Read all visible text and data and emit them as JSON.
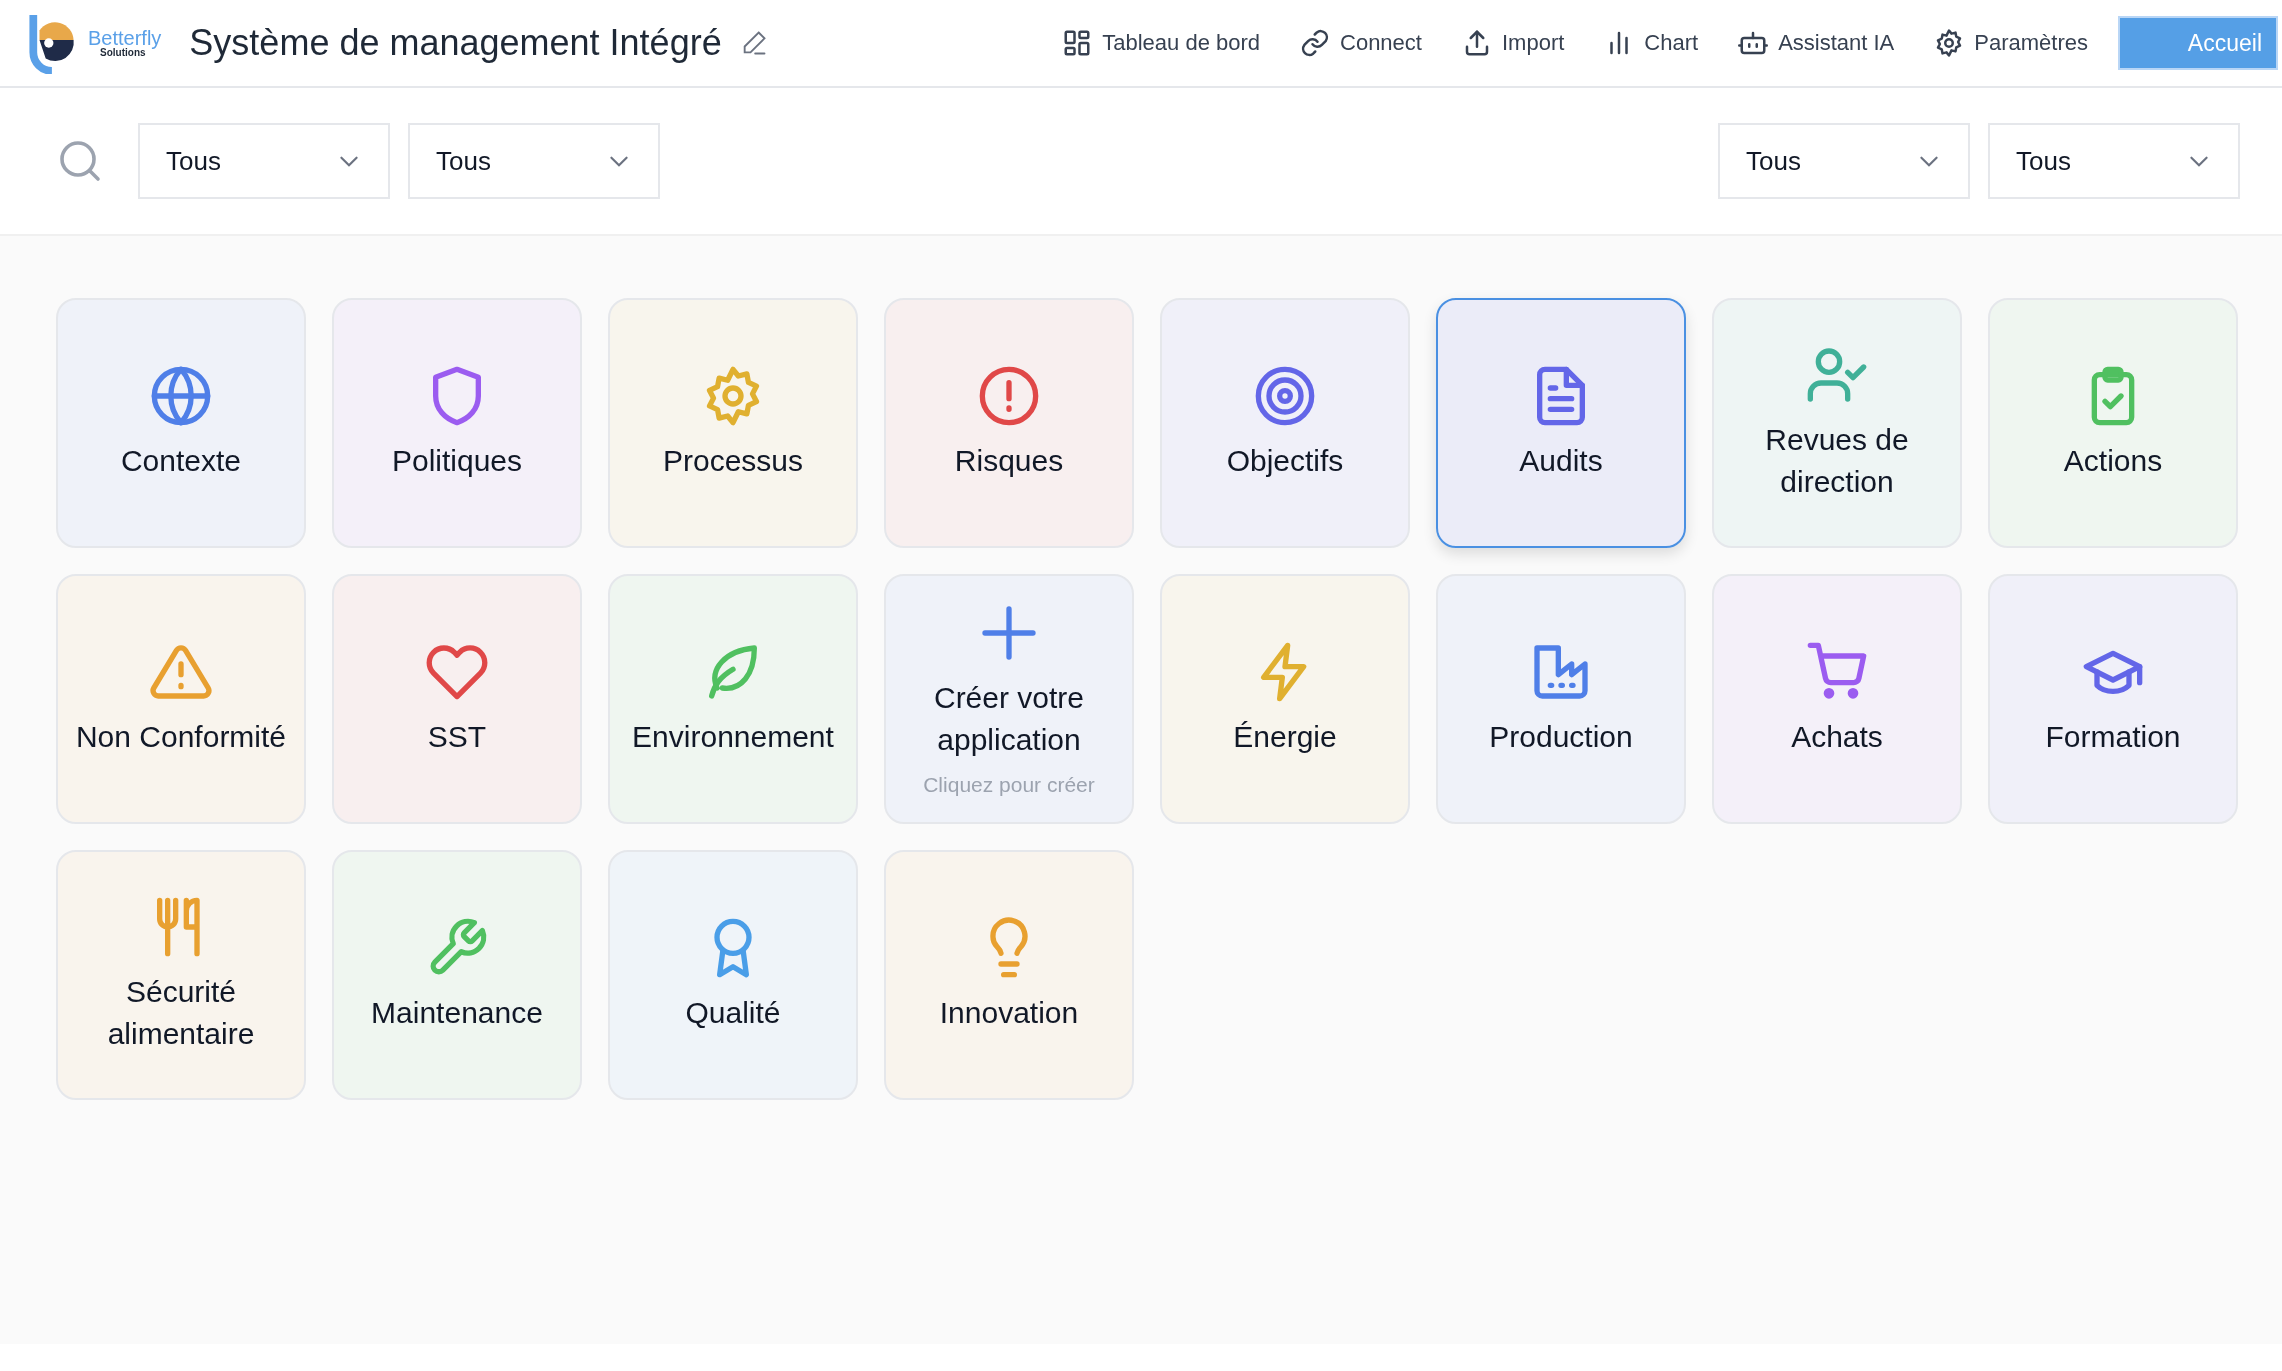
{
  "header": {
    "logo": {
      "name": "Betterfly",
      "tagline": "Solutions"
    },
    "title": "Système de management Intégré",
    "nav": [
      {
        "label": "Tableau de bord",
        "kind": "grid"
      },
      {
        "label": "Connect",
        "kind": "link"
      },
      {
        "label": "Import",
        "kind": "upload"
      },
      {
        "label": "Chart",
        "kind": "bars"
      },
      {
        "label": "Assistant IA",
        "kind": "robot"
      },
      {
        "label": "Paramètres",
        "kind": "gear"
      }
    ],
    "home_button": "Accueil"
  },
  "filters": {
    "left": [
      "Tous",
      "Tous"
    ],
    "right": [
      "Tous",
      "Tous"
    ]
  },
  "tiles": [
    {
      "label": "Contexte",
      "kind": "globe",
      "color": "#4f7fe8",
      "selected": false
    },
    {
      "label": "Politiques",
      "kind": "shield",
      "color": "#9b5cf0",
      "selected": false
    },
    {
      "label": "Processus",
      "kind": "gear",
      "color": "#e0b030",
      "selected": false
    },
    {
      "label": "Risques",
      "kind": "alert",
      "color": "#e04848",
      "selected": false
    },
    {
      "label": "Objectifs",
      "kind": "target",
      "color": "#6366e8",
      "selected": false
    },
    {
      "label": "Audits",
      "kind": "doc",
      "color": "#6366e8",
      "selected": true
    },
    {
      "label": "Revues de direction",
      "kind": "usercheck",
      "color": "#40b098",
      "selected": false
    },
    {
      "label": "Actions",
      "kind": "clipboard",
      "color": "#50c060",
      "selected": false
    },
    {
      "label": "Non Conformité",
      "kind": "warning",
      "color": "#e8a030",
      "selected": false
    },
    {
      "label": "SST",
      "kind": "heart",
      "color": "#e04848",
      "selected": false
    },
    {
      "label": "Environnement",
      "kind": "leaf",
      "color": "#50c060",
      "selected": false
    },
    {
      "label": "Créer votre application",
      "kind": "plus",
      "color": "#4f7fe8",
      "subtitle": "Cliquez pour créer",
      "selected": false
    },
    {
      "label": "Énergie",
      "kind": "bolt",
      "color": "#e0b030",
      "selected": false
    },
    {
      "label": "Production",
      "kind": "factory",
      "color": "#4f7fe8",
      "selected": false
    },
    {
      "label": "Achats",
      "kind": "cart",
      "color": "#9b5cf0",
      "selected": false
    },
    {
      "label": "Formation",
      "kind": "cap",
      "color": "#6366e8",
      "selected": false
    },
    {
      "label": "Sécurité alimentaire",
      "kind": "fork",
      "color": "#e8a030",
      "selected": false
    },
    {
      "label": "Maintenance",
      "kind": "wrench",
      "color": "#50c060",
      "selected": false
    },
    {
      "label": "Qualité",
      "kind": "award",
      "color": "#4a9ee8",
      "selected": false
    },
    {
      "label": "Innovation",
      "kind": "bulb",
      "color": "#e8a030",
      "selected": false
    }
  ]
}
